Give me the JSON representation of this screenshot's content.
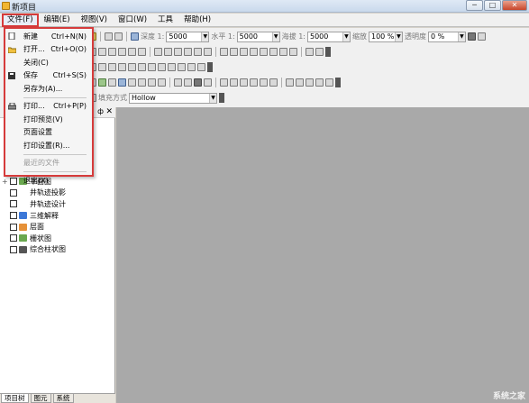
{
  "window": {
    "title": "新项目",
    "minimize": "─",
    "maximize": "□",
    "close": "✕"
  },
  "menubar": {
    "items": [
      "文件(F)",
      "编辑(E)",
      "视图(V)",
      "窗口(W)",
      "工具",
      "帮助(H)"
    ]
  },
  "file_menu": {
    "items": [
      {
        "label": "新建",
        "shortcut": "Ctrl+N(N)",
        "icon": "new-file-icon"
      },
      {
        "label": "打开...",
        "shortcut": "Ctrl+O(O)",
        "icon": "open-folder-icon"
      },
      {
        "label": "关闭(C)",
        "shortcut": ""
      },
      {
        "label": "保存",
        "shortcut": "Ctrl+S(S)",
        "icon": "save-disk-icon"
      },
      {
        "label": "另存为(A)...",
        "shortcut": ""
      },
      {
        "label": "打印...",
        "shortcut": "Ctrl+P(P)",
        "icon": "printer-icon"
      },
      {
        "label": "打印预览(V)",
        "shortcut": ""
      },
      {
        "label": "页面设置",
        "shortcut": ""
      },
      {
        "label": "打印设置(R)...",
        "shortcut": ""
      },
      {
        "label": "最近的文件",
        "shortcut": "",
        "disabled": true
      },
      {
        "label": "退出(X)",
        "shortcut": ""
      }
    ]
  },
  "toolbar": {
    "depth_label": "深度 1:",
    "depth_value": "5000",
    "horizontal_label": "水平 1:",
    "horizontal_value": "5000",
    "elevation_label": "海拔 1:",
    "elevation_value": "5000",
    "zoom_label": "缩放",
    "zoom_value": "100 %",
    "transparency_label": "透明度",
    "transparency_value": "0 %",
    "fill_mode_label": "填充方式",
    "fill_mode_value": "Hollow"
  },
  "panel": {
    "pin_icon": "pin-icon",
    "close": "✕"
  },
  "tree": {
    "items": [
      {
        "label": "平面图",
        "icon_color": "#6aa84f",
        "expand": "+"
      },
      {
        "label": "井轨迹投影",
        "icon_color": ""
      },
      {
        "label": "井轨迹设计",
        "icon_color": ""
      },
      {
        "label": "三维解释",
        "icon_color": "#3c78d8"
      },
      {
        "label": "层面",
        "icon_color": "#e69138"
      },
      {
        "label": "栅状图",
        "icon_color": "#6aa84f"
      },
      {
        "label": "综合柱状图",
        "icon_color": "#555555"
      }
    ]
  },
  "tabs": [
    "项目树",
    "图元",
    "系统"
  ],
  "watermark": "系统之家"
}
